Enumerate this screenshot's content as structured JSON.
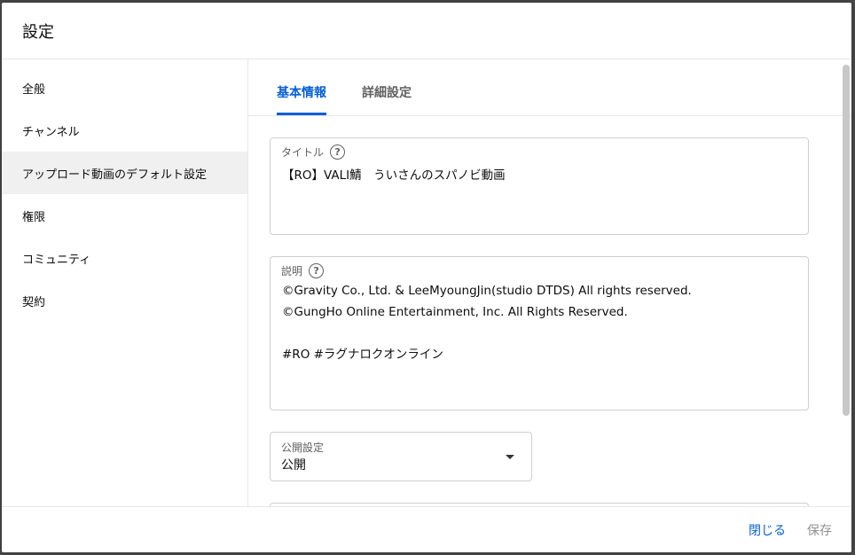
{
  "dialog": {
    "title": "設定"
  },
  "sidebar": {
    "items": [
      {
        "label": "全般"
      },
      {
        "label": "チャンネル"
      },
      {
        "label": "アップロード動画のデフォルト設定"
      },
      {
        "label": "権限"
      },
      {
        "label": "コミュニティ"
      },
      {
        "label": "契約"
      }
    ],
    "active_index": 2
  },
  "tabs": [
    {
      "label": "基本情報"
    },
    {
      "label": "詳細設定"
    }
  ],
  "form": {
    "title_label": "タイトル",
    "title_value": "【RO】VALI鯖　ういさんのスパノビ動画",
    "description_label": "説明",
    "description_value": "©Gravity Co., Ltd. & LeeMyoungJin(studio DTDS) All rights reserved.\n©GungHo Online Entertainment, Inc. All Rights Reserved.\n\n#RO #ラグナロクオンライン",
    "visibility_label": "公開設定",
    "visibility_value": "公開"
  },
  "footer": {
    "close_label": "閉じる",
    "save_label": "保存"
  },
  "icons": {
    "help": "help-circle-icon",
    "dropdown": "dropdown-arrow-icon"
  },
  "colors": {
    "accent": "#065fd4",
    "active_sidebar_bg": "#f0f0f0"
  }
}
